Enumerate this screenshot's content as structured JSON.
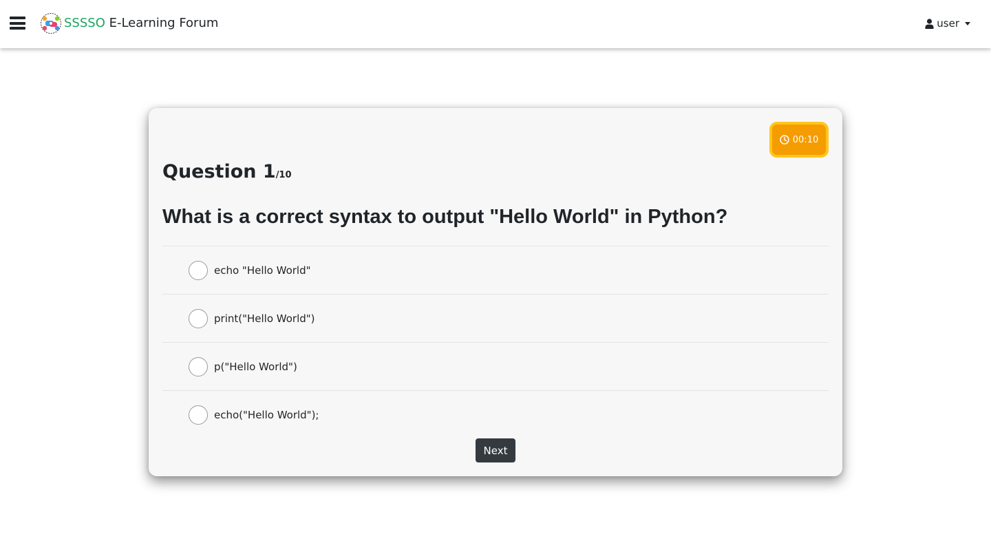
{
  "navbar": {
    "menu_icon": "hamburger-menu-icon",
    "logo_icon": "forum-logo-icon",
    "brand_accent": "SSSSO",
    "brand_rest": " E-Learning Forum",
    "user_icon": "user-icon",
    "user_label": "user",
    "dropdown_icon": "caret-down-icon"
  },
  "quiz": {
    "timer_icon": "clock-icon",
    "timer": "00:10",
    "question_label": "Question 1",
    "question_total": "/10",
    "question": "What is a correct syntax to output \"Hello World\" in Python?",
    "options": [
      "echo \"Hello World\"",
      "print(\"Hello World\")",
      "p(\"Hello World\")",
      "echo(\"Hello World\");"
    ],
    "next_label": "Next"
  },
  "colors": {
    "brand_accent": "#1aa560",
    "timer_background": "#f59c00",
    "timer_border": "#ffc51a",
    "next_button": "#343a40",
    "card_background": "#f7f7f7"
  }
}
